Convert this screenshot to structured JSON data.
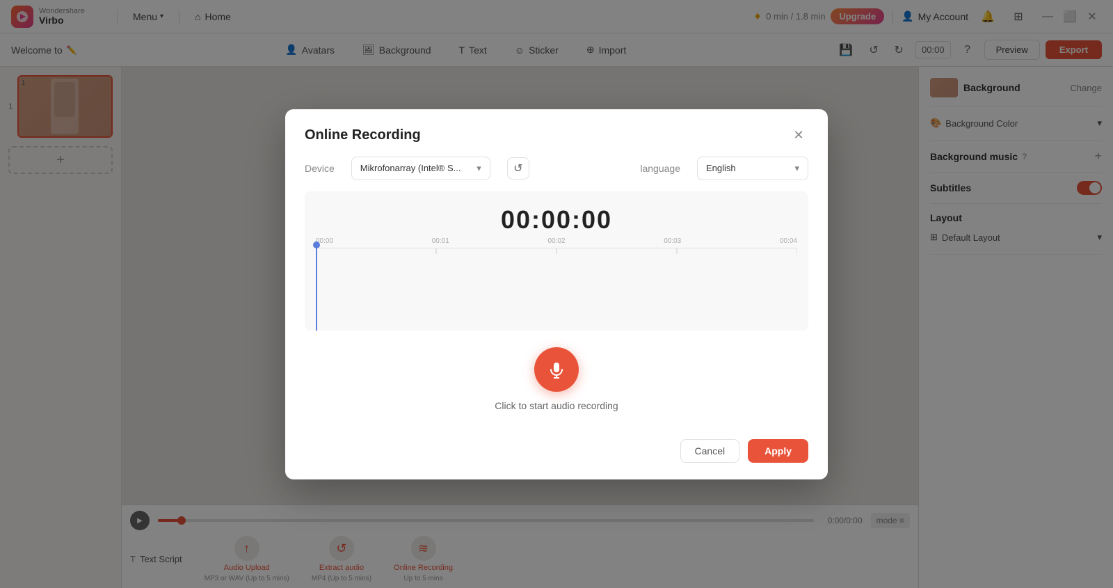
{
  "app": {
    "name": "Virbo",
    "logo_brand": "Wondershare"
  },
  "nav": {
    "menu_label": "Menu",
    "home_label": "Home",
    "upgrade_label": "Upgrade",
    "time_usage": "0 min / 1.8 min",
    "my_account": "My Account"
  },
  "toolbar": {
    "welcome_label": "Welcome to",
    "avatars_label": "Avatars",
    "background_label": "Background",
    "text_label": "Text",
    "sticker_label": "Sticker",
    "import_label": "Import",
    "time_code": "00:00",
    "preview_label": "Preview",
    "export_label": "Export"
  },
  "right_panel": {
    "background_label": "Background",
    "change_label": "Change",
    "background_color_label": "Background Color",
    "background_music_label": "Background music",
    "subtitles_label": "Subtitles",
    "layout_label": "Layout",
    "default_layout_label": "Default Layout"
  },
  "bottom": {
    "text_script_label": "Text Script",
    "audio_upload_label": "Audio Upload",
    "audio_upload_sub": "MP3 or WAV (Up to 5 mins)",
    "extract_audio_label": "Extract audio",
    "extract_audio_sub": "MP4 (Up to 5 mins)",
    "online_recording_label": "Online Recording",
    "online_recording_sub": "Up to 5 mins"
  },
  "modal": {
    "title": "Online Recording",
    "device_label": "Device",
    "device_value": "Mikrofonarray (Intel® S...",
    "language_label": "language",
    "language_value": "English",
    "timer": "00:00:00",
    "timeline_marks": [
      "00:00",
      "00:01",
      "00:02",
      "00:03",
      "00:04"
    ],
    "record_hint": "Click to start audio recording",
    "cancel_label": "Cancel",
    "apply_label": "Apply"
  }
}
